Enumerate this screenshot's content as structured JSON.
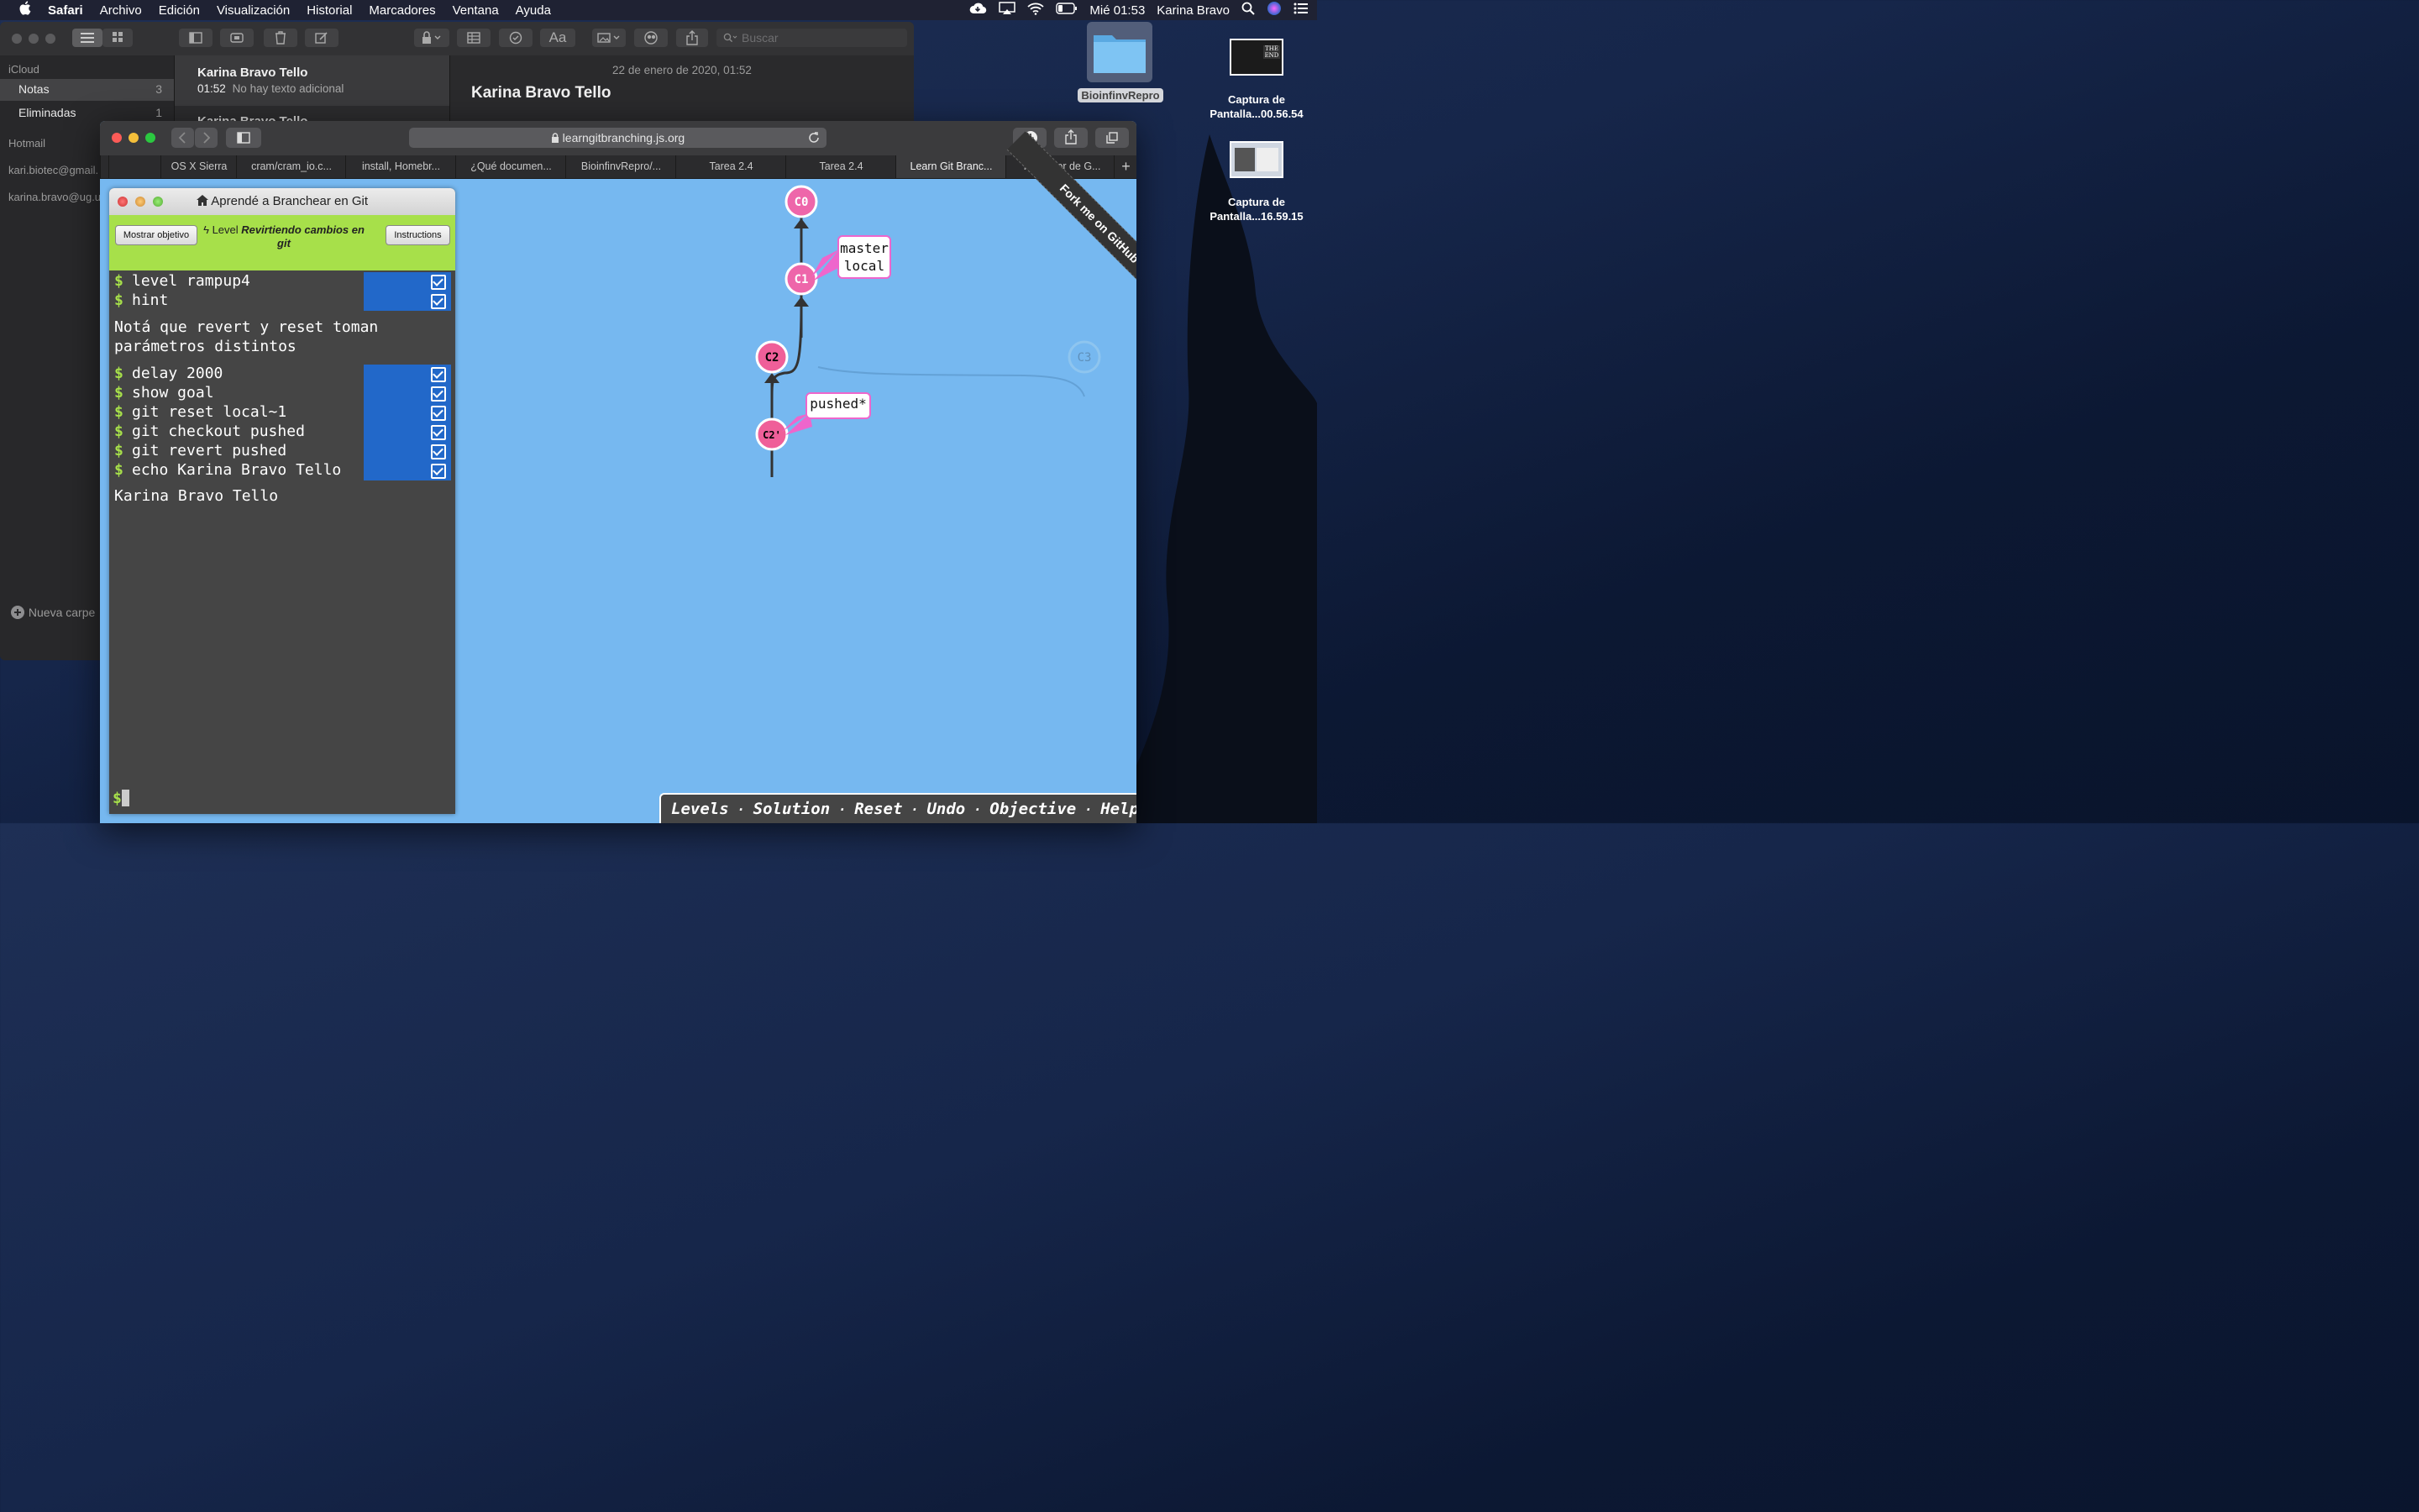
{
  "menubar": {
    "apple": "",
    "app": "Safari",
    "items": [
      "Archivo",
      "Edición",
      "Visualización",
      "Historial",
      "Marcadores",
      "Ventana",
      "Ayuda"
    ],
    "clock": "Mié 01:53",
    "user": "Karina Bravo"
  },
  "desktop": {
    "folder_label": "BioinfinvRepro",
    "screenshot1_label": "Captura de Pantalla...00.56.54",
    "screenshot2_label": "Captura de Pantalla...16.59.15",
    "thumb_text": "THE END"
  },
  "notes": {
    "search_placeholder": "Buscar",
    "sidebar": {
      "icloud": "iCloud",
      "notas": "Notas",
      "notas_count": "3",
      "eliminadas": "Eliminadas",
      "eliminadas_count": "1",
      "hotmail": "Hotmail",
      "account1": "kari.biotec@gmail.",
      "account2": "karina.bravo@ug.u",
      "new_folder": "Nueva carpe"
    },
    "list": {
      "title": "Karina Bravo Tello",
      "time": "01:52",
      "preview": "No hay texto adicional",
      "title2": "Karina Bravo Tello"
    },
    "content": {
      "date": "22 de enero de 2020, 01:52",
      "heading": "Karina Bravo Tello"
    }
  },
  "safari": {
    "url": "learngitbranching.js.org",
    "tabs": [
      "",
      "",
      "OS X Sierra",
      "cram/cram_io.c...",
      "install, Homebr...",
      "¿Qué documen...",
      "BioinfinvRepro/...",
      "Tarea 2.4",
      "Tarea 2.4",
      "Learn Git Branc...",
      "Traductor de G..."
    ],
    "active_tab_index": 9,
    "new_tab": "+"
  },
  "lgb": {
    "window_title": "Aprendé a Branchear en Git",
    "show_goal": "Mostrar objetivo",
    "level_prefix": "Level",
    "level_name": "Revirtiendo cambios en git",
    "instructions": "Instructions",
    "commands_a": [
      "level rampup4",
      "hint"
    ],
    "hint_text_1": "Notá que revert y reset toman",
    "hint_text_2": "parámetros distintos",
    "commands_b": [
      "delay 2000",
      "show goal",
      "git reset local~1",
      "git checkout pushed",
      "git revert pushed",
      "echo Karina Bravo Tello"
    ],
    "echo_output": "Karina Bravo Tello",
    "prompt": "$",
    "fork_ribbon": "Fork me on GitHub"
  },
  "graph": {
    "commits": [
      {
        "id": "C0",
        "state": "active"
      },
      {
        "id": "C1",
        "state": "active"
      },
      {
        "id": "C2",
        "state": "active"
      },
      {
        "id": "C2'",
        "state": "active"
      },
      {
        "id": "C3",
        "state": "orphaned"
      }
    ],
    "branches": [
      {
        "name": "master\nlocal",
        "line1": "master",
        "line2": "local",
        "target": "C1"
      },
      {
        "name": "pushed*",
        "target": "C2'"
      }
    ],
    "colors": {
      "commit": "#ee66aa",
      "commit_alt": "#ef5f99",
      "background": "#76b8f0",
      "edge": "#333333"
    }
  },
  "command_bar": {
    "links": [
      "Levels",
      "Solution",
      "Reset",
      "Undo",
      "Objective",
      "Help"
    ],
    "separator": "·"
  }
}
